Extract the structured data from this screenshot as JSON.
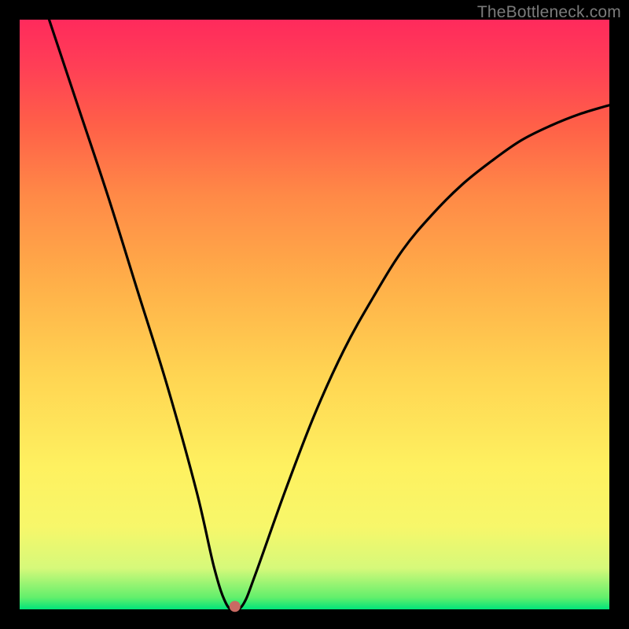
{
  "watermark": "TheBottleneck.com",
  "chart_data": {
    "type": "line",
    "title": "",
    "xlabel": "",
    "ylabel": "",
    "xlim": [
      0,
      100
    ],
    "ylim": [
      0,
      100
    ],
    "grid": false,
    "series": [
      {
        "name": "bottleneck-curve",
        "x": [
          5,
          10,
          15,
          20,
          25,
          30,
          33,
          35,
          36.5,
          38,
          40,
          45,
          50,
          55,
          60,
          65,
          70,
          75,
          80,
          85,
          90,
          95,
          100
        ],
        "y": [
          100,
          85,
          70,
          54,
          38,
          20,
          7,
          1,
          0,
          1,
          6,
          20,
          33,
          44,
          53,
          61,
          67,
          72,
          76,
          79.5,
          82,
          84,
          85.5
        ]
      }
    ],
    "marker": {
      "x_pct": 36.5,
      "y_pct": 0.5,
      "color": "#c96a63",
      "radius_px": 7
    },
    "colors": {
      "curve": "#000000",
      "background_top": "#ff2a5c",
      "background_mid": "#ffd452",
      "background_bottom": "#00e47a",
      "frame": "#000000"
    }
  }
}
